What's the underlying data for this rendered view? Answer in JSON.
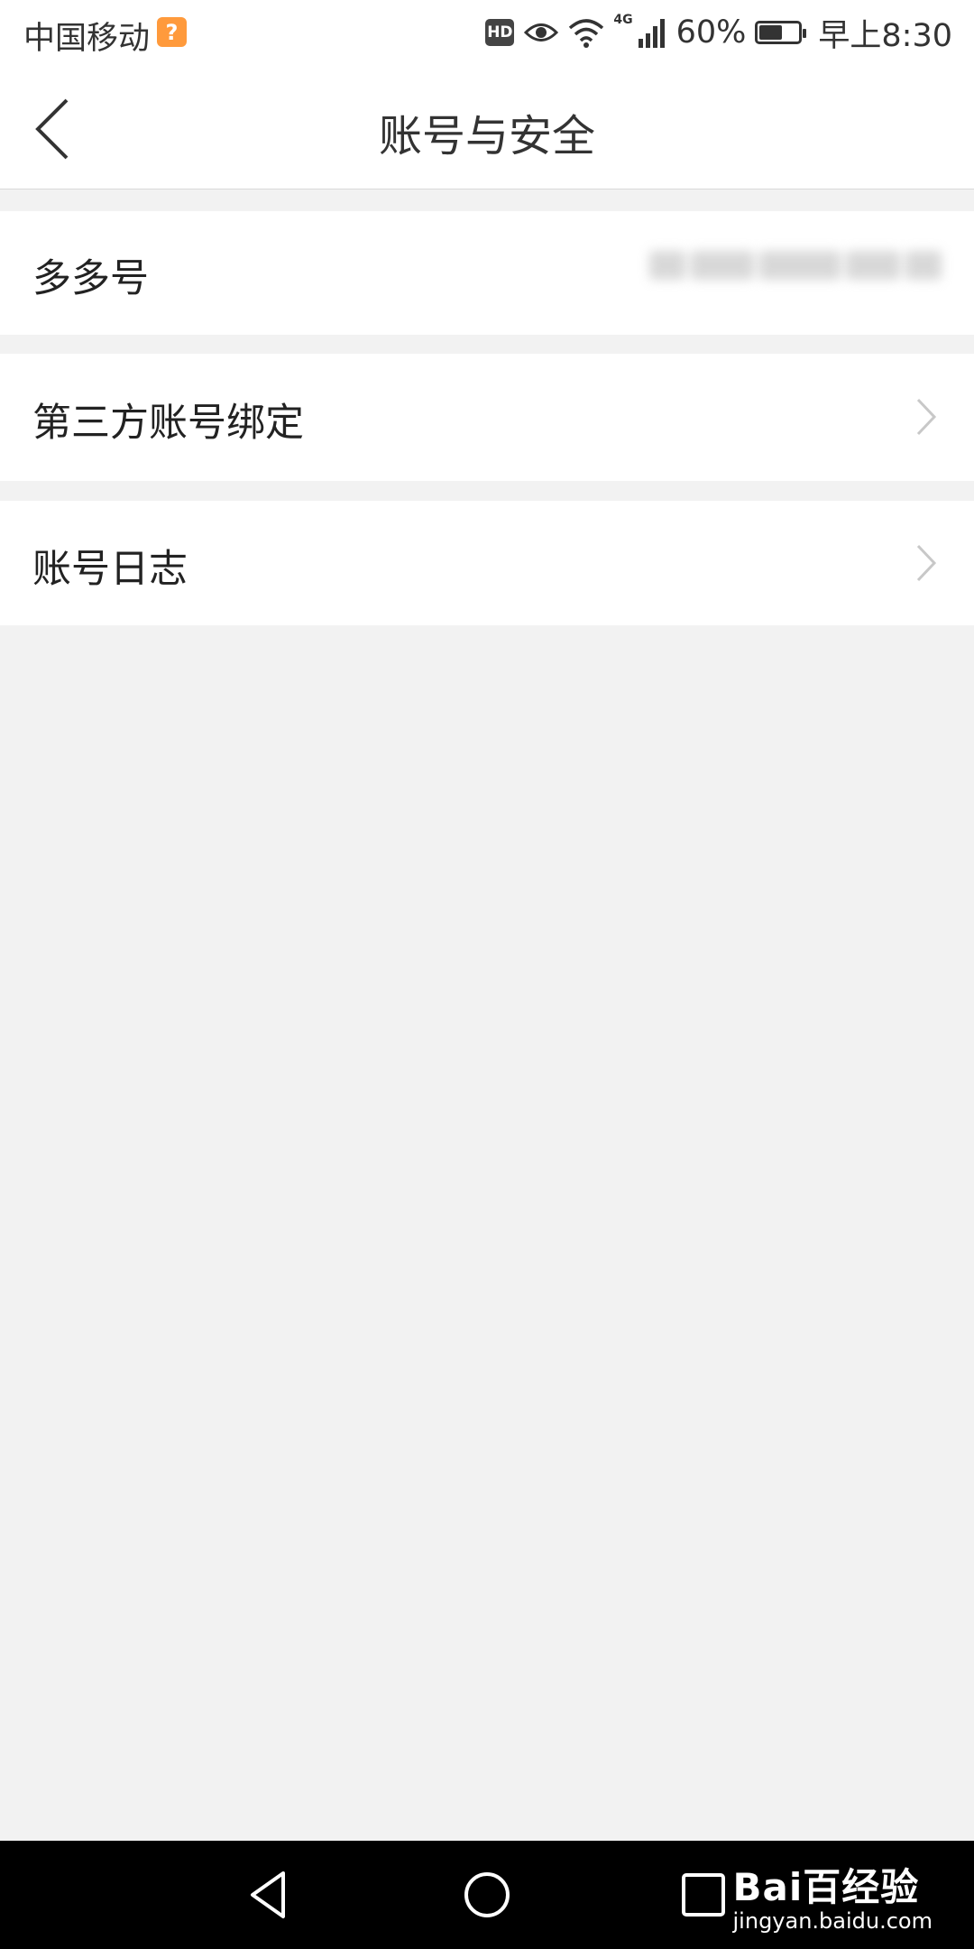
{
  "status_bar": {
    "carrier": "中国移动",
    "carrier_badge": "?",
    "hd_label": "HD",
    "network": "4G",
    "battery_percent": "60%",
    "battery_level": 0.6,
    "time": "早上8:30"
  },
  "header": {
    "title": "账号与安全"
  },
  "rows": [
    {
      "label": "多多号",
      "has_chevron": false
    },
    {
      "label": "第三方账号绑定",
      "has_chevron": true
    },
    {
      "label": "账号日志",
      "has_chevron": true
    }
  ],
  "icons": {
    "back": "back-arrow-icon",
    "chevron": "chevron-right-icon",
    "nav_back": "triangle-back-icon",
    "nav_home": "circle-home-icon",
    "nav_recents": "square-recents-icon"
  },
  "watermark": {
    "logo": "Bai百经验",
    "url": "jingyan.baidu.com"
  },
  "colors": {
    "background": "#f2f2f2",
    "card": "#ffffff",
    "badge": "#ff9a3c",
    "chevron": "#c8c8c8"
  }
}
